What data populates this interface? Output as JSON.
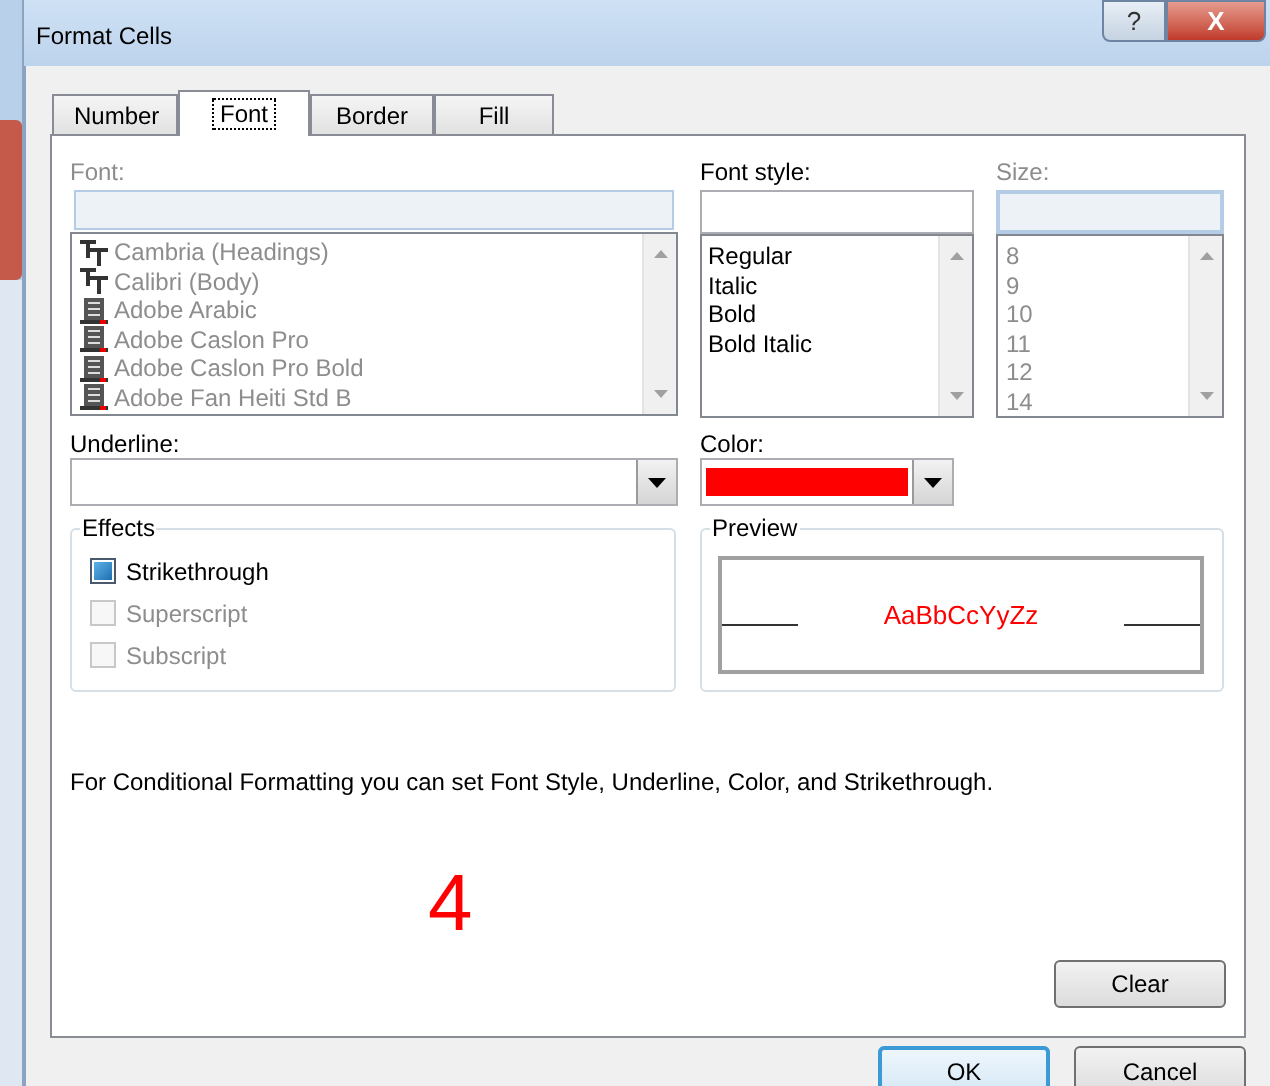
{
  "window": {
    "title": "Format Cells",
    "buttons": [
      {
        "kind": "help",
        "label": "?"
      },
      {
        "kind": "close",
        "label": "X"
      }
    ]
  },
  "tabs": [
    {
      "label": "Number",
      "selected": false
    },
    {
      "label": "Font",
      "selected": true
    },
    {
      "label": "Border",
      "selected": false
    },
    {
      "label": "Fill",
      "selected": false
    }
  ],
  "font": {
    "label": "Font:",
    "disabled": true,
    "items": [
      {
        "kind": "truetype",
        "label": "Cambria (Headings)"
      },
      {
        "kind": "truetype",
        "label": "Calibri (Body)"
      },
      {
        "kind": "opentype",
        "label": "Adobe Arabic"
      },
      {
        "kind": "opentype",
        "label": "Adobe Caslon Pro"
      },
      {
        "kind": "opentype",
        "label": "Adobe Caslon Pro Bold"
      },
      {
        "kind": "opentype",
        "label": "Adobe Fan Heiti Std B"
      }
    ]
  },
  "font_style": {
    "label": "Font style:",
    "disabled": false,
    "items": [
      "Regular",
      "Italic",
      "Bold",
      "Bold Italic"
    ]
  },
  "size": {
    "label": "Size:",
    "disabled": true,
    "items": [
      "8",
      "9",
      "10",
      "11",
      "12",
      "14"
    ]
  },
  "underline": {
    "label": "Underline:"
  },
  "color": {
    "label": "Color:",
    "color": "#ff0000"
  },
  "effects": {
    "title": "Effects",
    "options": [
      {
        "label": "Strikethrough",
        "checked": true,
        "disabled": false
      },
      {
        "label": "Superscript",
        "checked": false,
        "disabled": true
      },
      {
        "label": "Subscript",
        "checked": false,
        "disabled": true
      }
    ]
  },
  "preview": {
    "title": "Preview",
    "sample": "AaBbCcYyZz"
  },
  "note": "For Conditional Formatting you can set Font Style, Underline, Color, and Strikethrough.",
  "annotation": "4",
  "buttons": {
    "clear": "Clear",
    "ok": "OK",
    "cancel": "Cancel"
  }
}
